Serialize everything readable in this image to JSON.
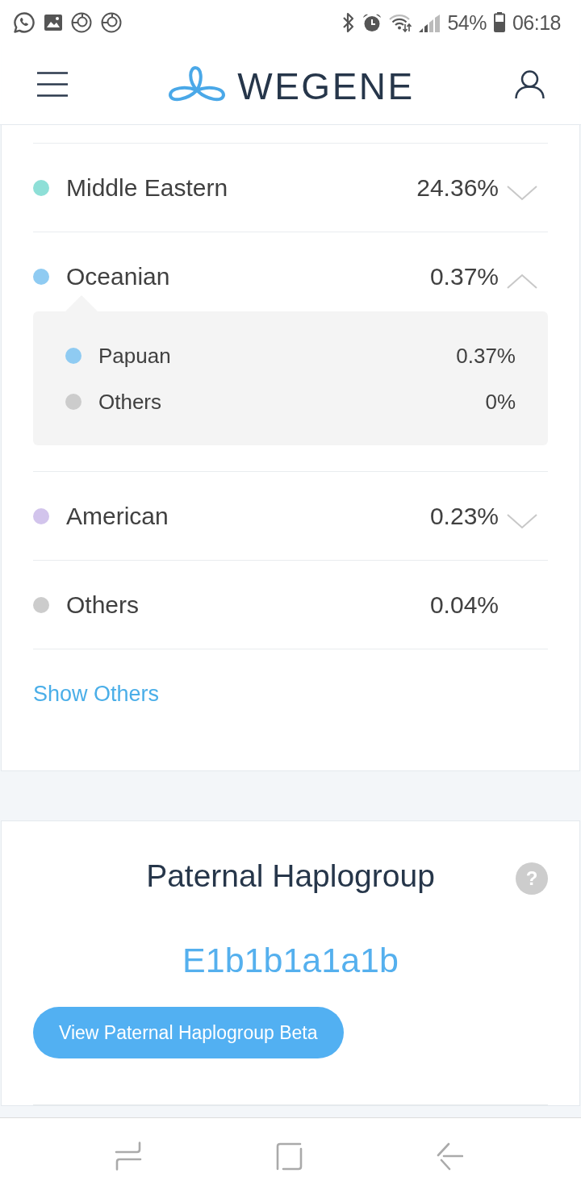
{
  "status_bar": {
    "battery": "54%",
    "time": "06:18"
  },
  "header": {
    "logo": "WEGENE"
  },
  "ancestry": {
    "rows": [
      {
        "name": "Middle Eastern",
        "value": "24.36%",
        "color": "#8edfd7",
        "kind": "expandable",
        "expanded": false
      },
      {
        "name": "Oceanian",
        "value": "0.37%",
        "color": "#8fcbf2",
        "kind": "expandable",
        "expanded": true,
        "children": [
          {
            "name": "Papuan",
            "value": "0.37%",
            "color": "#8fcbf2"
          },
          {
            "name": "Others",
            "value": "0%",
            "color": "#cccccc"
          }
        ]
      },
      {
        "name": "American",
        "value": "0.23%",
        "color": "#d2c4ec",
        "kind": "expandable",
        "expanded": false
      },
      {
        "name": "Others",
        "value": "0.04%",
        "color": "#cccccc",
        "kind": "plain",
        "expanded": false
      }
    ],
    "show_others": "Show Others"
  },
  "paternal_haplogroup": {
    "title": "Paternal Haplogroup",
    "help": "?",
    "value": "E1b1b1a1a1b",
    "button": "View Paternal Haplogroup Beta"
  }
}
